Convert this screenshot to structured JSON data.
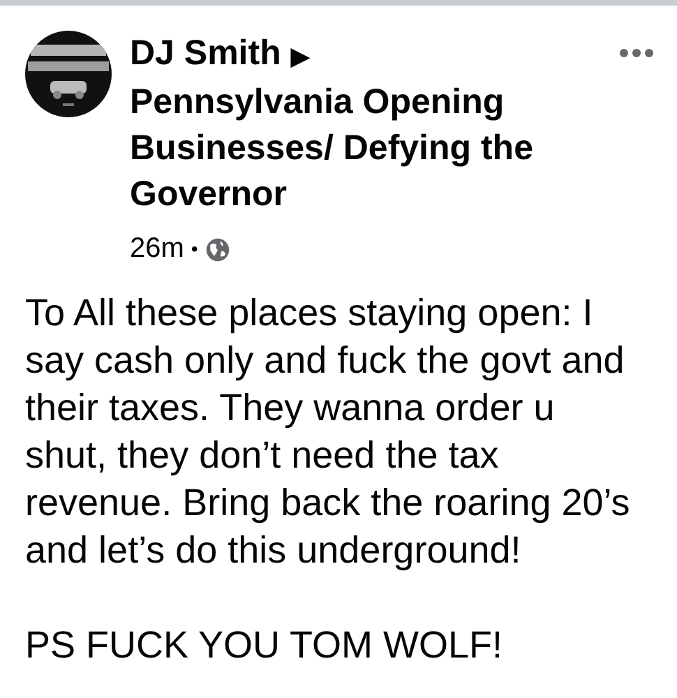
{
  "post": {
    "author": "DJ Smith",
    "separator": "▶",
    "group": "Pennsylvania Opening Businesses/ Defying the Governor",
    "time": "26m",
    "dot": "•",
    "public": true,
    "paragraphs": [
      "To All these places staying open: I say cash only and fuck the govt and their taxes. They wanna order u shut, they don’t need the tax revenue. Bring back the roaring 20’s and let’s do this underground!",
      "PS FUCK YOU TOM WOLF!"
    ]
  }
}
